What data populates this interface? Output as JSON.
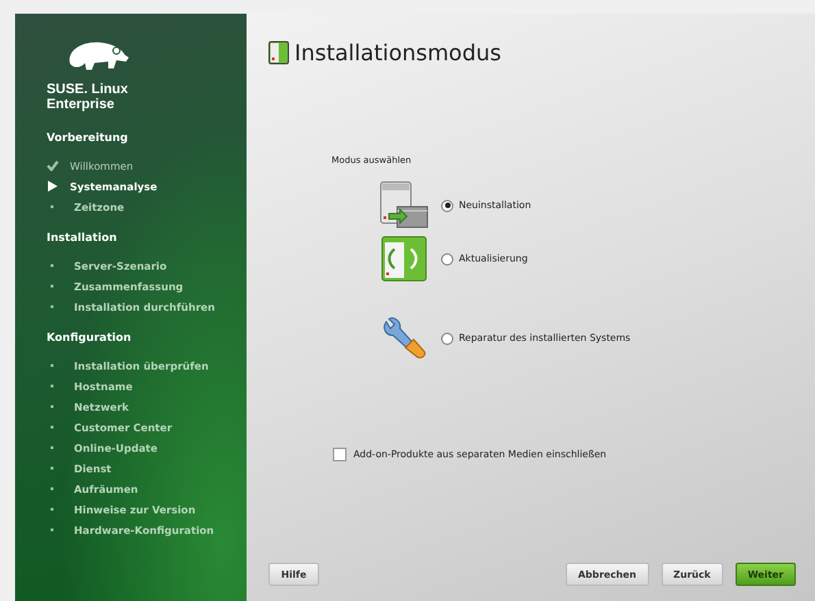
{
  "logo": {
    "text": "SUSE. Linux Enterprise"
  },
  "sidebar": {
    "sections": [
      {
        "title": "Vorbereitung",
        "items": [
          {
            "label": "Willkommen",
            "kind": "done"
          },
          {
            "label": "Systemanalyse",
            "kind": "current"
          },
          {
            "label": "Zeitzone",
            "kind": "pending"
          }
        ]
      },
      {
        "title": "Installation",
        "items": [
          {
            "label": "Server-Szenario",
            "kind": "pending"
          },
          {
            "label": "Zusammenfassung",
            "kind": "pending"
          },
          {
            "label": "Installation durchführen",
            "kind": "pending"
          }
        ]
      },
      {
        "title": "Konfiguration",
        "items": [
          {
            "label": "Installation überprüfen",
            "kind": "pending"
          },
          {
            "label": "Hostname",
            "kind": "pending"
          },
          {
            "label": "Netzwerk",
            "kind": "pending"
          },
          {
            "label": "Customer Center",
            "kind": "pending"
          },
          {
            "label": "Online-Update",
            "kind": "pending"
          },
          {
            "label": "Dienst",
            "kind": "pending"
          },
          {
            "label": "Aufräumen",
            "kind": "pending"
          },
          {
            "label": "Hinweise zur Version",
            "kind": "pending"
          },
          {
            "label": "Hardware-Konfiguration",
            "kind": "pending"
          }
        ]
      }
    ]
  },
  "title": "Installationsmodus",
  "mode_group": {
    "label": "Modus auswählen",
    "options": [
      {
        "label": "Neuinstallation",
        "kind": "install",
        "selected": true
      },
      {
        "label": "Aktualisierung",
        "kind": "update",
        "selected": false
      },
      {
        "label": "Reparatur des installierten Systems",
        "kind": "repair",
        "selected": false
      }
    ]
  },
  "addon_checkbox": {
    "label": "Add-on-Produkte aus separaten Medien einschließen",
    "checked": false
  },
  "buttons": {
    "help": "Hilfe",
    "actions": [
      {
        "label": "Abbrechen",
        "primary": false
      },
      {
        "label": "Zurück",
        "primary": false
      },
      {
        "label": "Weiter",
        "primary": true
      }
    ]
  }
}
